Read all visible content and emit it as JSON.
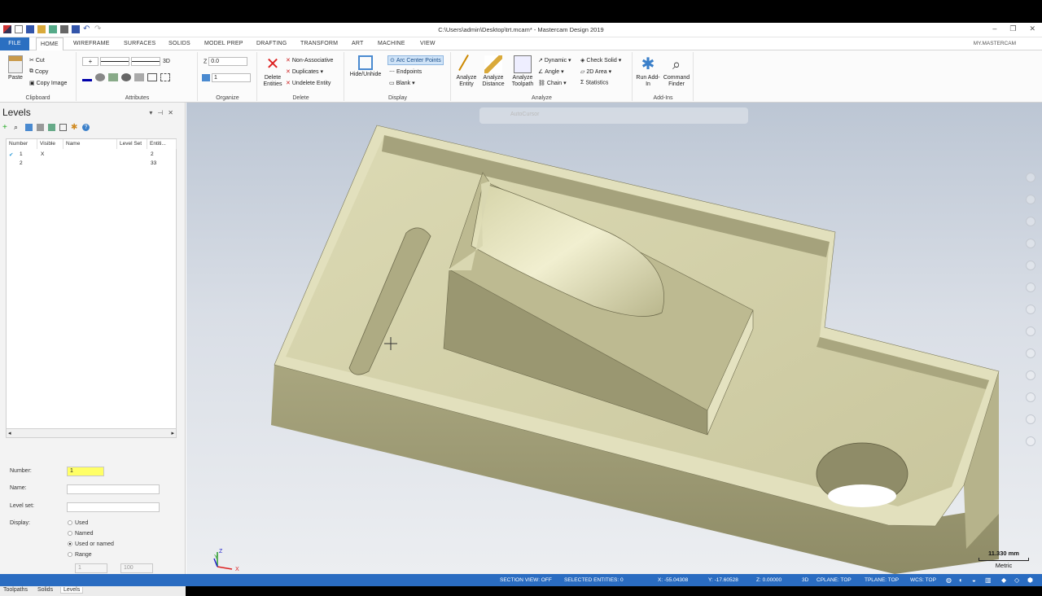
{
  "window": {
    "title": "C:\\Users\\admin\\Desktop\\trt.mcam* - Mastercam Design 2019",
    "account": "MY.MASTERCAM"
  },
  "tabs": [
    "FILE",
    "HOME",
    "WIREFRAME",
    "SURFACES",
    "SOLIDS",
    "MODEL PREP",
    "DRAFTING",
    "TRANSFORM",
    "ART",
    "MACHINE",
    "VIEW"
  ],
  "ribbon": {
    "clipboard": {
      "label": "Clipboard",
      "paste": "Paste",
      "cut": "Cut",
      "copy": "Copy",
      "copy_image": "Copy Image"
    },
    "attributes": {
      "label": "Attributes",
      "mode": "3D"
    },
    "organize": {
      "label": "Organize",
      "z_label": "Z",
      "z_value": "0.0",
      "level_value": "1"
    },
    "delete": {
      "label": "Delete",
      "delete_entities": "Delete Entities",
      "non_associative": "Non-Associative",
      "duplicates": "Duplicates",
      "undelete_entity": "Undelete Entity"
    },
    "display": {
      "label": "Display",
      "hide_unhide": "Hide/Unhide",
      "arc_center_points": "Arc Center Points",
      "endpoints": "Endpoints",
      "blank": "Blank"
    },
    "analyze": {
      "label": "Analyze",
      "analyze_entity": "Analyze Entity",
      "analyze_distance": "Analyze Distance",
      "analyze_toolpath": "Analyze Toolpath",
      "dynamic": "Dynamic",
      "angle": "Angle",
      "chain": "Chain",
      "check_solid": "Check Solid",
      "area_2d": "2D Area",
      "statistics": "Statistics"
    },
    "addins": {
      "label": "Add-Ins",
      "run_addin": "Run Add-In",
      "command_finder": "Command Finder"
    }
  },
  "levels": {
    "title": "Levels",
    "columns": [
      "Number",
      "Visible",
      "Name",
      "Level Set",
      "Entiti..."
    ],
    "rows": [
      {
        "number": "1",
        "visible": "X",
        "name": "",
        "level_set": "",
        "entities": "2"
      },
      {
        "number": "2",
        "visible": "",
        "name": "",
        "level_set": "",
        "entities": "33"
      }
    ],
    "form": {
      "number_label": "Number:",
      "number_value": "1",
      "name_label": "Name:",
      "level_set_label": "Level set:",
      "display_label": "Display:",
      "options": [
        "Used",
        "Named",
        "Used or named",
        "Range"
      ],
      "selected": "Used or named",
      "range_from": "1",
      "range_to": "100"
    },
    "bottom_tabs": [
      "Toolpaths",
      "Solids",
      "Levels"
    ]
  },
  "viewport": {
    "scale_value": "11.330 mm",
    "scale_unit": "Metric",
    "axis_x": "X",
    "axis_y": "Y",
    "axis_z": "Z",
    "autocursor": "AutoCursor"
  },
  "status": {
    "section_view": "SECTION VIEW: OFF",
    "selected": "SELECTED ENTITIES: 0",
    "x": "X:   -55.04308",
    "y": "Y:   -17.60528",
    "z": "Z:   0.00000",
    "mode": "3D",
    "cplane": "CPLANE: TOP",
    "tplane": "TPLANE: TOP",
    "wcs": "WCS: TOP"
  },
  "colors": {
    "accent": "#2b6fc1",
    "statusbar": "#2a6cc1",
    "part": "#c2c096",
    "highlight": "#ffff66"
  }
}
